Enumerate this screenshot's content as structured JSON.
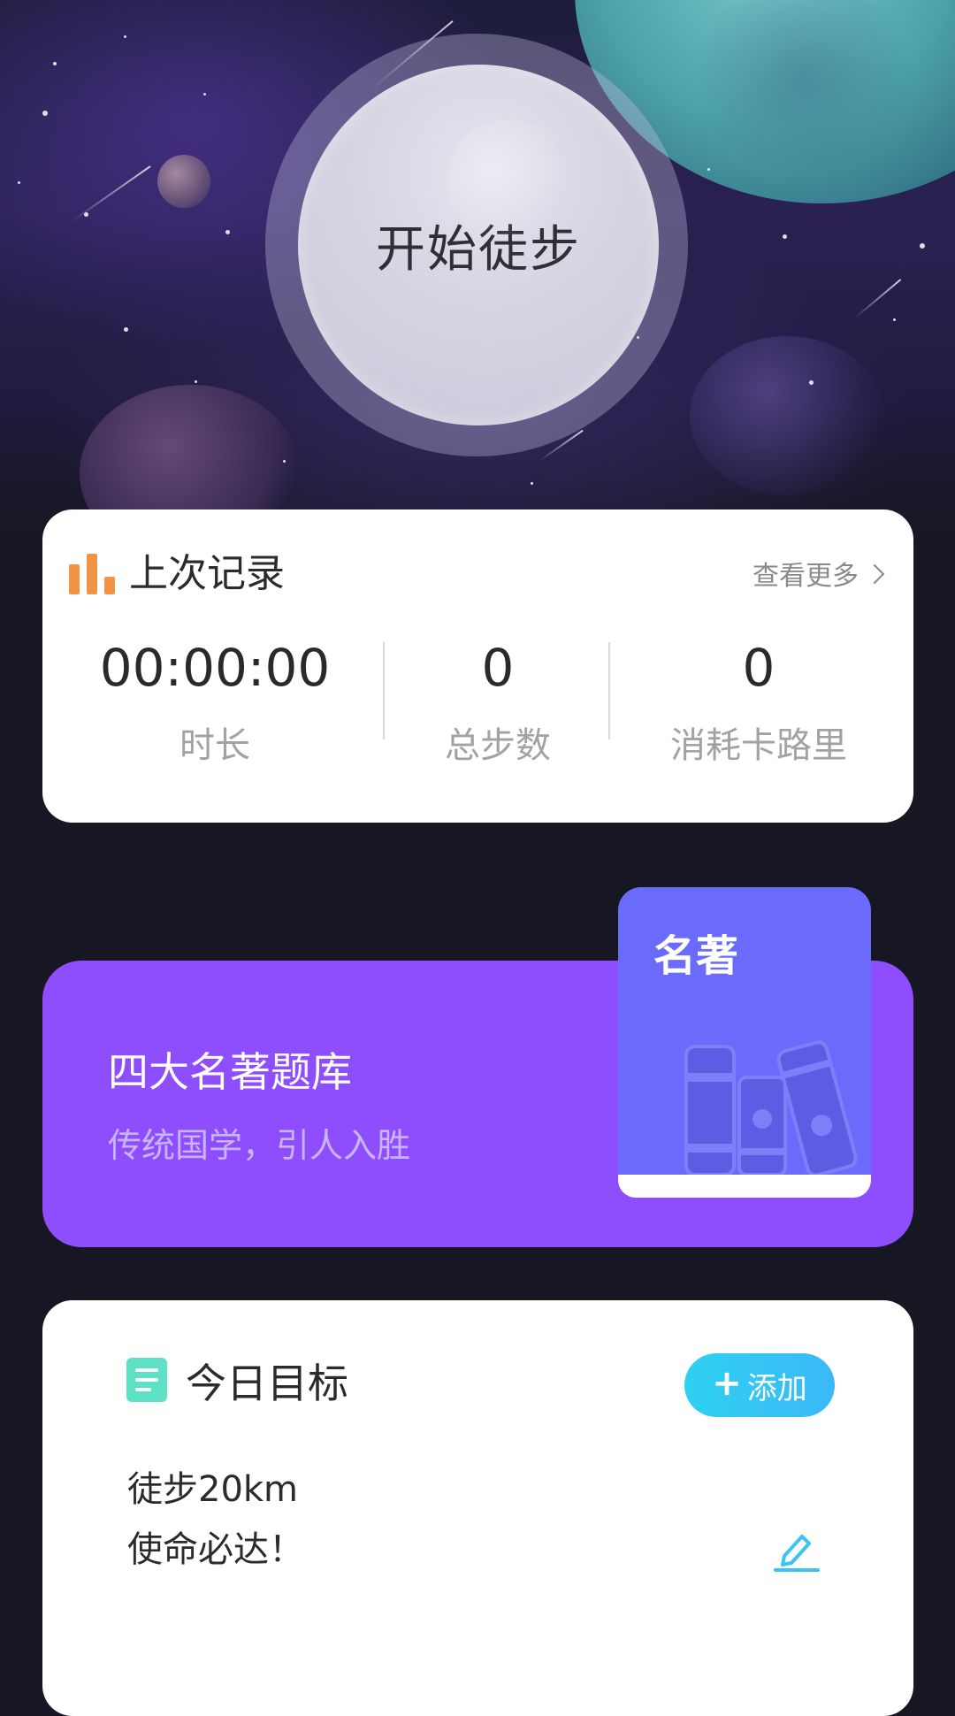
{
  "hero": {
    "start_button_label": "开始徒步"
  },
  "last_record": {
    "title": "上次记录",
    "more_label": "查看更多",
    "stats": [
      {
        "value": "00:00:00",
        "label": "时长"
      },
      {
        "value": "0",
        "label": "总步数"
      },
      {
        "value": "0",
        "label": "消耗卡路里"
      }
    ]
  },
  "book_banner": {
    "title": "四大名著题库",
    "subtitle": "传统国学，引人入胜",
    "cover_title": "名著"
  },
  "today_goal": {
    "title": "今日目标",
    "add_label": "添加",
    "add_icon": "+",
    "goal_line1": "徒步20km",
    "goal_line2": "使命必达！"
  },
  "colors": {
    "background": "#171723",
    "record_icon": "#f09445",
    "book_banner": "#8f4efe",
    "book_cover": "#6a6bfa",
    "add_button": "#2fd0f2",
    "goal_icon": "#5de2c5"
  },
  "icons": [
    "bar-chart-icon",
    "chevron-right-icon",
    "books-icon",
    "list-icon",
    "plus-icon",
    "edit-icon"
  ]
}
